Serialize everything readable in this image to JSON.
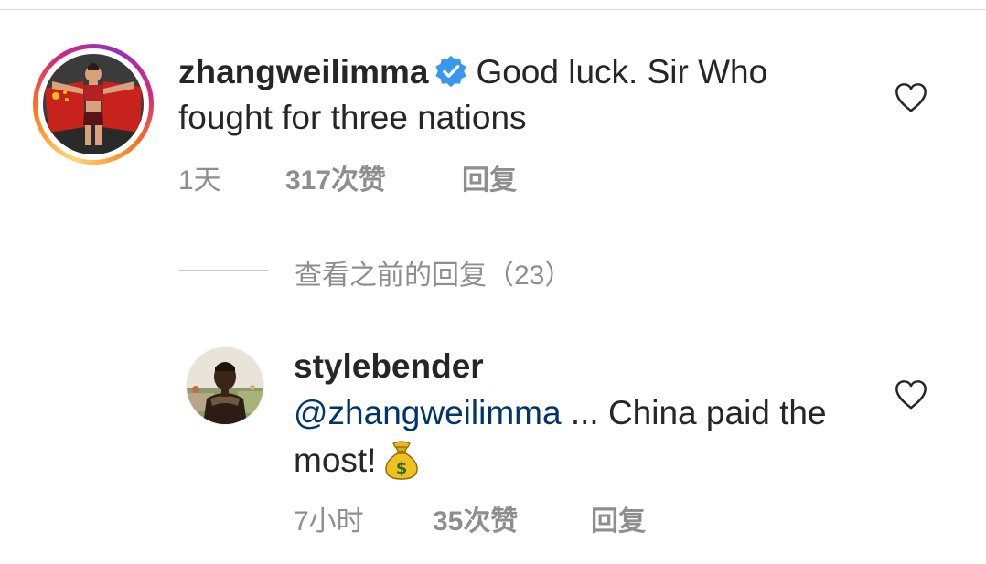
{
  "comments": [
    {
      "username": "zhangweilimma",
      "text": "Good luck. Sir Who fought for three nations",
      "time": "1天",
      "likes": "317次赞",
      "reply_label": "回复",
      "verified": true,
      "avatar_icon": "fighter-holding-flag-avatar",
      "story_ring": true
    },
    {
      "username": "stylebender",
      "mention": "@zhangweilimma",
      "text": " ... China paid the most!",
      "emoji": "money-bag-icon",
      "time": "7小时",
      "likes": "35次赞",
      "reply_label": "回复",
      "avatar_icon": "fighter-portrait-avatar"
    }
  ],
  "view_previous": {
    "label": "查看之前的回复（23）"
  },
  "colors": {
    "text": "#262626",
    "meta": "#8e8e8e",
    "mention": "#003569",
    "verified": "#3897f0",
    "divider": "#dbdbdb"
  }
}
